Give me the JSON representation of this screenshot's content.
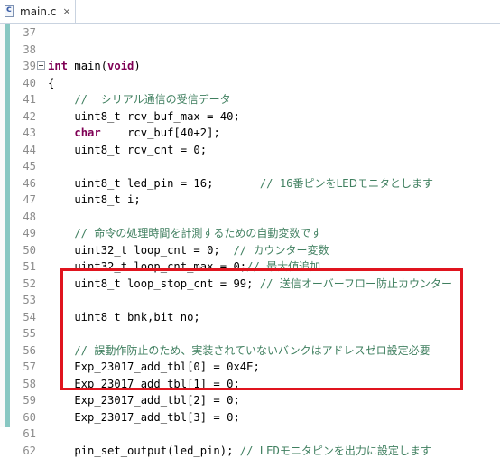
{
  "tab": {
    "title": "main.c",
    "close_glyph": "×",
    "file_icon": "c-source-file-icon",
    "file_icon_letter": "c"
  },
  "colors": {
    "keyword": "#7f0055",
    "comment": "#3f7f5f",
    "line_number": "#8c8c8c",
    "change_bar": "#88c7c2",
    "highlight_box": "#e0141e"
  },
  "lines": [
    {
      "num": "37",
      "fold": false,
      "parts": [
        {
          "t": "",
          "c": "plain"
        }
      ]
    },
    {
      "num": "38",
      "fold": false,
      "parts": [
        {
          "t": "",
          "c": "plain"
        }
      ]
    },
    {
      "num": "39",
      "fold": true,
      "parts": [
        {
          "t": "int",
          "c": "kw"
        },
        {
          "t": " main(",
          "c": "plain"
        },
        {
          "t": "void",
          "c": "kw"
        },
        {
          "t": ")",
          "c": "plain"
        }
      ]
    },
    {
      "num": "40",
      "fold": false,
      "parts": [
        {
          "t": "{",
          "c": "plain"
        }
      ]
    },
    {
      "num": "41",
      "fold": false,
      "parts": [
        {
          "t": "    //  ",
          "c": "cm"
        },
        {
          "t": "シリアル通信の受信データ",
          "c": "cmjp"
        }
      ]
    },
    {
      "num": "42",
      "fold": false,
      "parts": [
        {
          "t": "    uint8_t rcv_buf_max = 40;",
          "c": "plain"
        }
      ]
    },
    {
      "num": "43",
      "fold": false,
      "parts": [
        {
          "t": "    ",
          "c": "plain"
        },
        {
          "t": "char",
          "c": "kw"
        },
        {
          "t": "    rcv_buf[40+2];",
          "c": "plain"
        }
      ]
    },
    {
      "num": "44",
      "fold": false,
      "parts": [
        {
          "t": "    uint8_t rcv_cnt = 0;",
          "c": "plain"
        }
      ]
    },
    {
      "num": "45",
      "fold": false,
      "parts": [
        {
          "t": "",
          "c": "plain"
        }
      ]
    },
    {
      "num": "46",
      "fold": false,
      "parts": [
        {
          "t": "    uint8_t led_pin = 16;       ",
          "c": "plain"
        },
        {
          "t": "// 16",
          "c": "cm"
        },
        {
          "t": "番ピンをLEDモニタとします",
          "c": "cmjp"
        }
      ]
    },
    {
      "num": "47",
      "fold": false,
      "parts": [
        {
          "t": "    uint8_t i;",
          "c": "plain"
        }
      ]
    },
    {
      "num": "48",
      "fold": false,
      "parts": [
        {
          "t": "",
          "c": "plain"
        }
      ]
    },
    {
      "num": "49",
      "fold": false,
      "parts": [
        {
          "t": "    // ",
          "c": "cm"
        },
        {
          "t": "命令の処理時間を計測するための自動変数です",
          "c": "cmjp"
        }
      ]
    },
    {
      "num": "50",
      "fold": false,
      "parts": [
        {
          "t": "    uint32_t loop_cnt = 0;  ",
          "c": "plain"
        },
        {
          "t": "// ",
          "c": "cm"
        },
        {
          "t": "カウンター変数",
          "c": "cmjp"
        }
      ]
    },
    {
      "num": "51",
      "fold": false,
      "parts": [
        {
          "t": "    uint32_t loop_cnt_max = 0;",
          "c": "plain"
        },
        {
          "t": "// ",
          "c": "cm"
        },
        {
          "t": "最大値追加",
          "c": "cmjp"
        }
      ]
    },
    {
      "num": "52",
      "fold": false,
      "parts": [
        {
          "t": "    uint8_t loop_stop_cnt = 99; ",
          "c": "plain"
        },
        {
          "t": "// ",
          "c": "cm"
        },
        {
          "t": "送信オーバーフロー防止カウンター",
          "c": "cmjp"
        }
      ]
    },
    {
      "num": "53",
      "fold": false,
      "parts": [
        {
          "t": "",
          "c": "plain"
        }
      ]
    },
    {
      "num": "54",
      "fold": false,
      "parts": [
        {
          "t": "    uint8_t bnk,bit_no;",
          "c": "plain"
        }
      ]
    },
    {
      "num": "55",
      "fold": false,
      "parts": [
        {
          "t": "",
          "c": "plain"
        }
      ]
    },
    {
      "num": "56",
      "fold": false,
      "parts": [
        {
          "t": "    // ",
          "c": "cm"
        },
        {
          "t": "誤動作防止のため、実装されていないバンクはアドレスゼロ設定必要",
          "c": "cmjp"
        }
      ]
    },
    {
      "num": "57",
      "fold": false,
      "parts": [
        {
          "t": "    Exp_23017_add_tbl[0] = 0x4E;",
          "c": "plain"
        }
      ]
    },
    {
      "num": "58",
      "fold": false,
      "parts": [
        {
          "t": "    Exp_23017_add_tbl[1] = 0;",
          "c": "plain"
        }
      ]
    },
    {
      "num": "59",
      "fold": false,
      "parts": [
        {
          "t": "    Exp_23017_add_tbl[2] = 0;",
          "c": "plain"
        }
      ]
    },
    {
      "num": "60",
      "fold": false,
      "parts": [
        {
          "t": "    Exp_23017_add_tbl[3] = 0;",
          "c": "plain"
        }
      ]
    },
    {
      "num": "61",
      "fold": false,
      "parts": [
        {
          "t": "",
          "c": "plain"
        }
      ]
    },
    {
      "num": "62",
      "fold": false,
      "parts": [
        {
          "t": "    pin_set_output(led_pin); ",
          "c": "plain"
        },
        {
          "t": "// LED",
          "c": "cm"
        },
        {
          "t": "モニタピンを出力に設定します",
          "c": "cmjp"
        }
      ]
    }
  ]
}
